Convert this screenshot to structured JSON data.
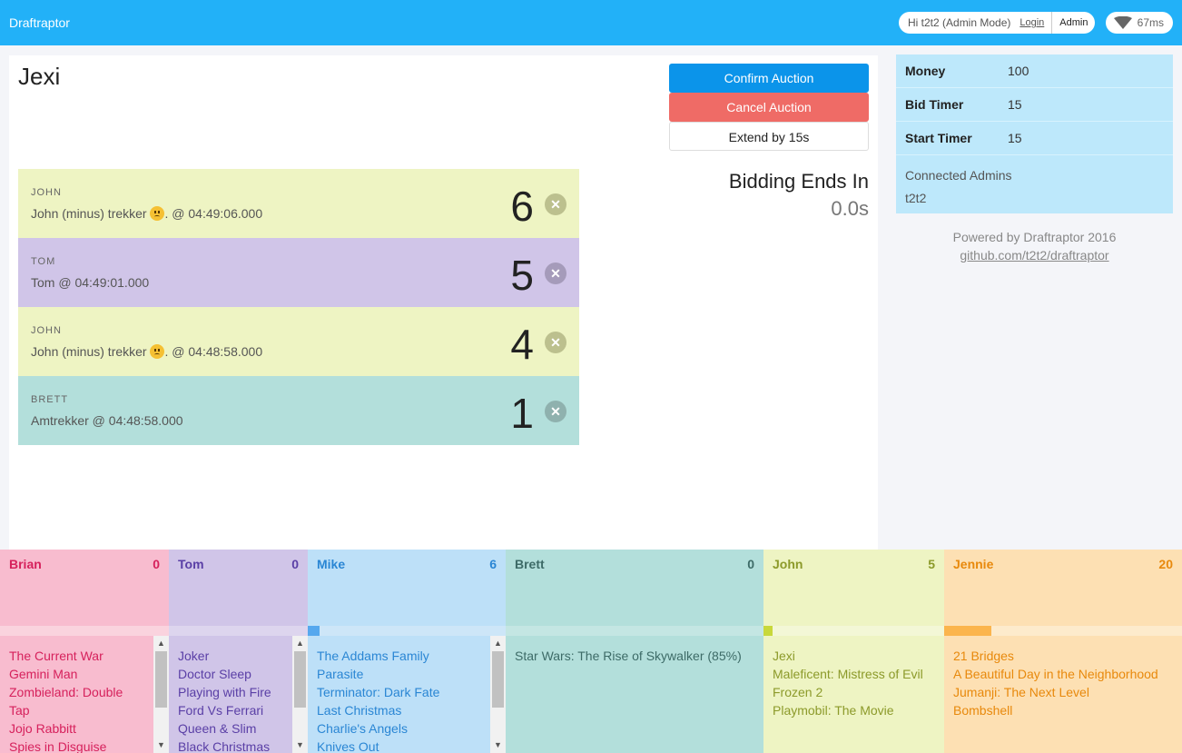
{
  "topbar": {
    "brand": "Draftraptor",
    "greeting": "Hi t2t2 (Admin Mode)",
    "login": "Login",
    "admin": "Admin",
    "ping": "67ms"
  },
  "auction": {
    "title": "Jexi",
    "confirm": "Confirm Auction",
    "cancel": "Cancel Auction",
    "extend": "Extend by 15s",
    "ends_label": "Bidding Ends In",
    "ends_value": "0.0s"
  },
  "bids": [
    {
      "who": "JOHN",
      "pre": "John (minus) trekker",
      "post": ". @ 04:49:06.000",
      "amount": "6",
      "emoji": true,
      "color": "#eef4c3",
      "xcolor": "#bcc08e"
    },
    {
      "who": "TOM",
      "pre": "Tom @ 04:49:01.000",
      "post": "",
      "amount": "5",
      "emoji": false,
      "color": "#d0c5e8",
      "xcolor": "#a59bba"
    },
    {
      "who": "JOHN",
      "pre": "John (minus) trekker",
      "post": ". @ 04:48:58.000",
      "amount": "4",
      "emoji": true,
      "color": "#eef4c3",
      "xcolor": "#bcc08e"
    },
    {
      "who": "BRETT",
      "pre": "Amtrekker @ 04:48:58.000",
      "post": "",
      "amount": "1",
      "emoji": false,
      "color": "#b3dfdb",
      "xcolor": "#8fb1ae"
    }
  ],
  "settings": [
    {
      "key": "Money",
      "value": "100"
    },
    {
      "key": "Bid Timer",
      "value": "15"
    },
    {
      "key": "Start Timer",
      "value": "15"
    }
  ],
  "admins": {
    "label": "Connected Admins",
    "list": "t2t2"
  },
  "footer": {
    "powered": "Powered by Draftraptor 2016",
    "link": "github.com/t2t2/draftraptor"
  },
  "teams": [
    {
      "name": "Brian",
      "score": "0",
      "bg": "#f8bccf",
      "text": "#d6215c",
      "barbg": "#fad3de",
      "barfill": "#f490b0",
      "fill": 0,
      "scroll": true,
      "items": [
        "The Current War",
        "Gemini Man",
        "Zombieland: Double Tap",
        "Jojo Rabbitt",
        "Spies in Disguise"
      ]
    },
    {
      "name": "Tom",
      "score": "0",
      "bg": "#d0c5e8",
      "text": "#5a3fa6",
      "barbg": "#ddd5ee",
      "barfill": "#9a85cc",
      "fill": 0,
      "scroll": true,
      "items": [
        "Joker",
        "Doctor Sleep",
        "Playing with Fire",
        "Ford Vs Ferrari",
        "Queen & Slim",
        "Black Christmas"
      ]
    },
    {
      "name": "Mike",
      "score": "6",
      "bg": "#bde0f8",
      "text": "#2a86d4",
      "barbg": "#cde6f8",
      "barfill": "#56a8ee",
      "fill": 0.06,
      "scroll": true,
      "items": [
        "The Addams Family",
        "Parasite",
        "Terminator: Dark Fate",
        "Last Christmas",
        "Charlie's Angels",
        "Knives Out"
      ]
    },
    {
      "name": "Brett",
      "score": "0",
      "bg": "#b3dfdb",
      "text": "#3d6b67",
      "barbg": "#c4e6e3",
      "barfill": "#7fc4be",
      "fill": 0,
      "scroll": false,
      "items": [
        "Star Wars: The Rise of Skywalker (85%)"
      ]
    },
    {
      "name": "John",
      "score": "5",
      "bg": "#eef4c3",
      "text": "#8c9a2a",
      "barbg": "#f3f7d6",
      "barfill": "#c8d83a",
      "fill": 0.05,
      "scroll": false,
      "items": [
        "Jexi",
        "Maleficent: Mistress of Evil",
        "Frozen 2",
        "Playmobil: The Movie"
      ]
    },
    {
      "name": "Jennie",
      "score": "20",
      "bg": "#fde0b3",
      "text": "#e8890c",
      "barbg": "#fdebcc",
      "barfill": "#fbb54d",
      "fill": 0.2,
      "scroll": false,
      "items": [
        "21 Bridges",
        "A Beautiful Day in the Neighborhood",
        "Jumanji: The Next Level",
        "Bombshell"
      ]
    }
  ]
}
